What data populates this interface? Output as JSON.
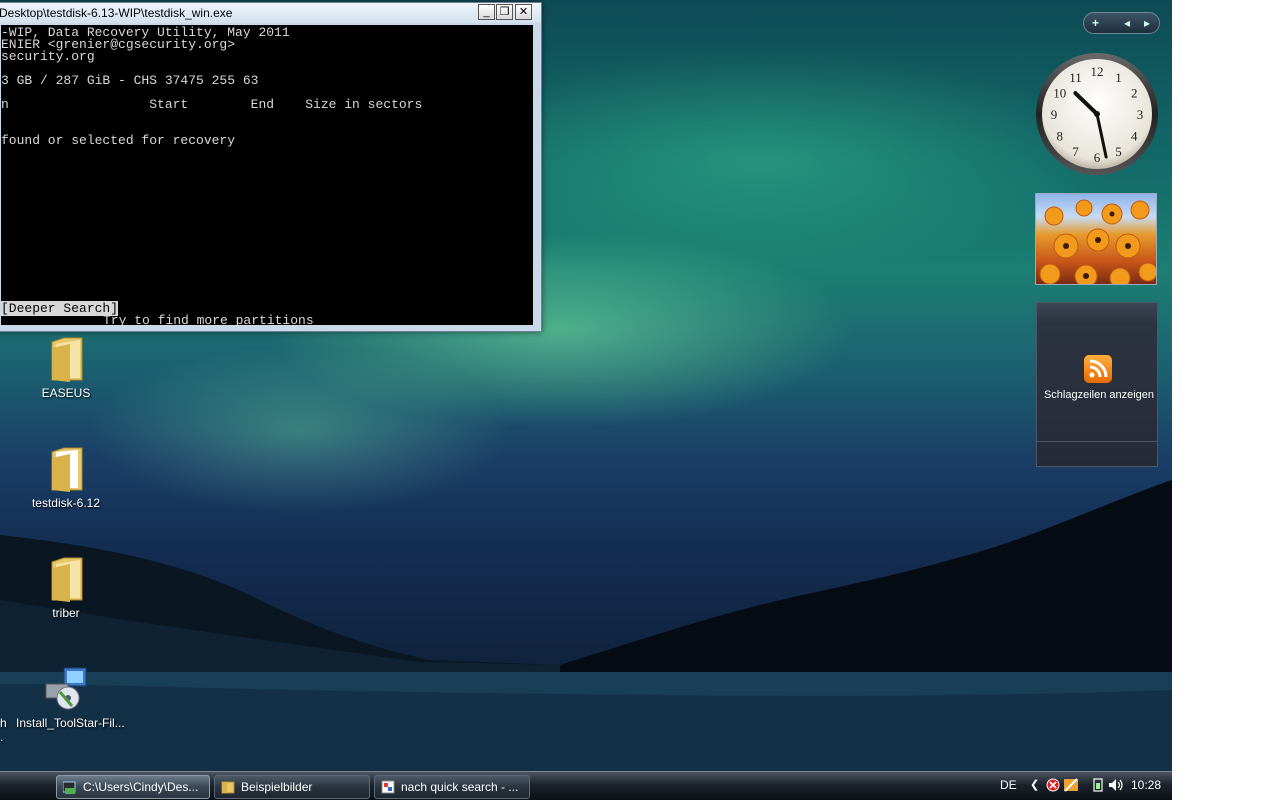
{
  "console_window": {
    "title": "Desktop\\testdisk-6.13-WIP\\testdisk_win.exe",
    "buttons": {
      "minimize": "_",
      "maximize": "❐",
      "close": "✕"
    },
    "lines": [
      "-WIP, Data Recovery Utility, May 2011",
      "ENIER <grenier@cgsecurity.org>",
      "security.org",
      "",
      "3 GB / 287 GiB - CHS 37475 255 63",
      "",
      "n                  Start        End    Size in sectors",
      "",
      "",
      "found or selected for recovery"
    ],
    "menu_option": "[Deeper Search]",
    "menu_hint": "Try to find more partitions"
  },
  "desktop_icons": [
    {
      "label": "EASEUS",
      "icon": "folder-icon"
    },
    {
      "label": "testdisk-6.12",
      "icon": "folder-icon"
    },
    {
      "label": "triber",
      "icon": "folder-icon"
    },
    {
      "label": "Install_ToolStar-Fil...",
      "icon": "installer-icon"
    }
  ],
  "desktop_edge_fragment": {
    "line1": "h",
    "line2": "."
  },
  "sidebar": {
    "toolbar": {
      "add": "+",
      "prev": "◂",
      "next": "▸"
    },
    "clock": {
      "hour": 10,
      "minute": 28
    },
    "feeds_label": "Schlagzeilen anzeigen"
  },
  "taskbar": {
    "tasks": [
      {
        "label": "C:\\Users\\Cindy\\Des...",
        "icon": "console-icon"
      },
      {
        "label": "Beispielbilder",
        "icon": "folder-icon"
      },
      {
        "label": "nach quick search - ...",
        "icon": "paint-icon"
      }
    ],
    "language": "DE",
    "time": "10:28"
  },
  "colors": {
    "console_bg": "#000000",
    "console_text": "#d8d8d8",
    "taskbar": "#1c232b"
  }
}
